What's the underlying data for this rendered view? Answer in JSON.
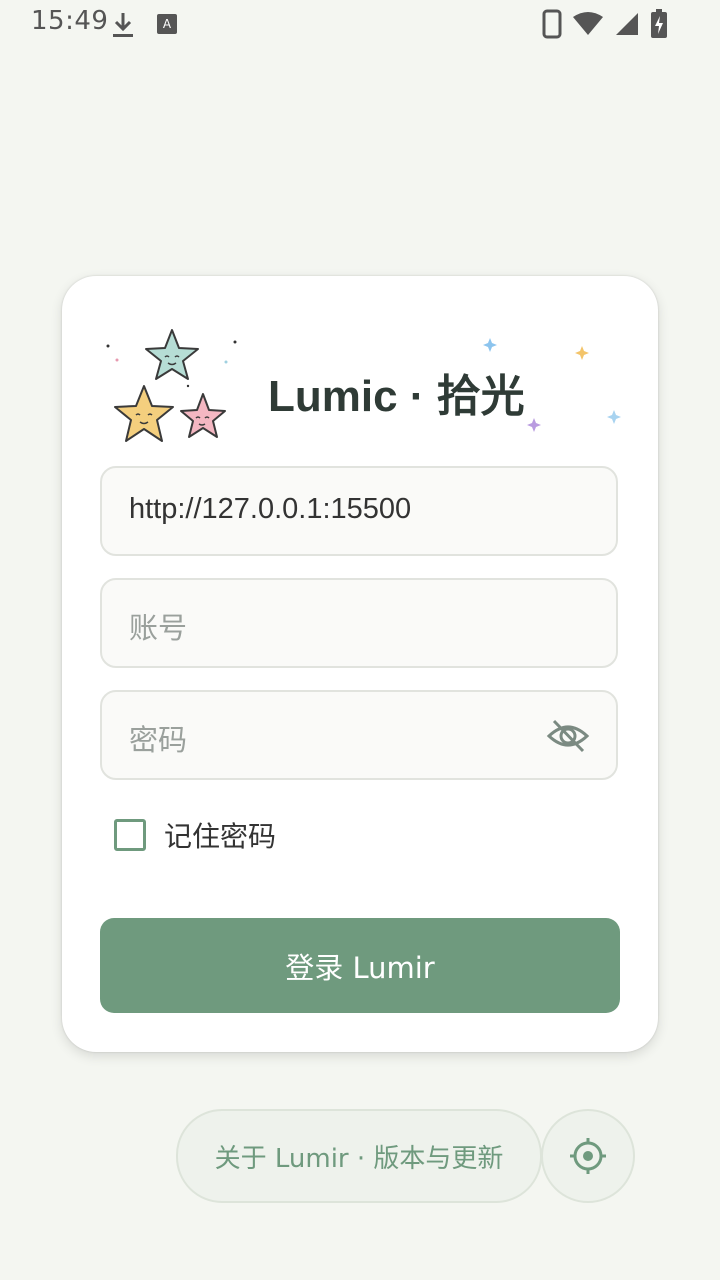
{
  "status_bar": {
    "time": "15:49",
    "icons": [
      "download-icon",
      "a-badge-icon",
      "phone-icon",
      "wifi-icon",
      "signal-icon",
      "battery-charging-icon"
    ]
  },
  "login_card": {
    "title": "Lumic · 拾光",
    "logo_icon": "stars-logo-icon",
    "server_field": {
      "value": "http://127.0.0.1:15500",
      "placeholder": ""
    },
    "account_field": {
      "value": "",
      "placeholder": "账号"
    },
    "password_field": {
      "value": "",
      "placeholder": "密码",
      "toggle_icon": "eye-off-icon"
    },
    "remember": {
      "label": "记住密码",
      "checked": false
    },
    "login_button": "登录 Lumir"
  },
  "footer": {
    "about_button": "关于 Lumir · 版本与更新",
    "settings_icon": "gear-icon"
  },
  "colors": {
    "accent": "#6f9a7e",
    "background": "#f4f6f1",
    "card": "#ffffff",
    "title": "#2f3b36"
  }
}
